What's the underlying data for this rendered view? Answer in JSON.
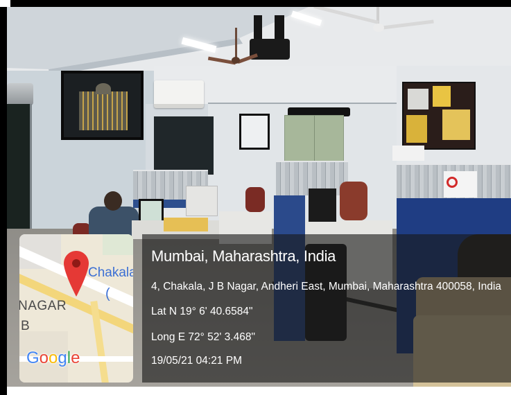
{
  "stamp": {
    "title": "Mumbai, Maharashtra, India",
    "address": "4, Chakala, J B Nagar, Andheri East, Mumbai, Maharashtra 400058, India",
    "lat": "Lat N 19° 6' 40.6584\"",
    "long": "Long E 72° 52' 3.468\"",
    "datetime": "19/05/21 04:21 PM"
  },
  "map": {
    "place_label": "Chakala",
    "place_label_2": "(",
    "area_label": "NAGAR",
    "area_label_2": "B",
    "logo": "Google",
    "logo_colors": [
      "#4285F4",
      "#EA4335",
      "#FBBC05",
      "#4285F4",
      "#34A853",
      "#EA4335"
    ],
    "pin_color": "#E53935",
    "pin_icon": "map-pin-icon"
  }
}
